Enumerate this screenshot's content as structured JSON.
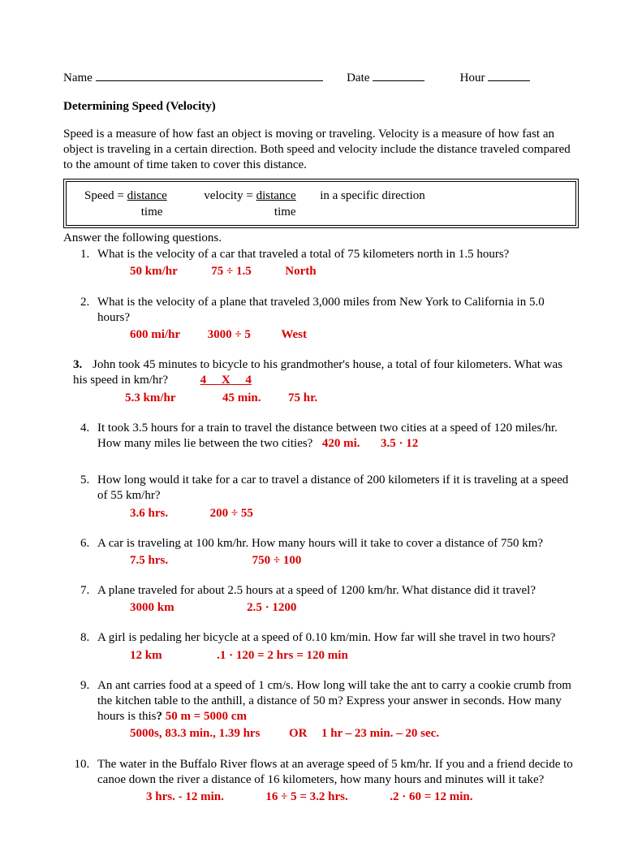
{
  "header": {
    "name_label": "Name",
    "date_label": "Date",
    "hour_label": "Hour"
  },
  "title": "Determining Speed (Velocity)",
  "intro": "Speed is a measure of how fast an object is moving or traveling.  Velocity is a measure of how fast an object is traveling in a certain direction.  Both speed and velocity include the distance traveled compared to the amount of time taken to cover this distance.",
  "formula": {
    "speed_label": "Speed = ",
    "speed_num": "distance",
    "speed_den": "time",
    "vel_label": "velocity = ",
    "vel_num": "distance",
    "vel_den": "time",
    "direction": "in a specific direction"
  },
  "answer_heading": "Answer the following questions.",
  "q1": {
    "text": "What is the velocity of a car that traveled a total of 75 kilometers north in 1.5 hours?",
    "a1": "50 km/hr",
    "a2": "75 ÷ 1.5",
    "a3": "North"
  },
  "q2": {
    "text": "What is the velocity of a plane that traveled 3,000 miles from New York to California in 5.0 hours?",
    "a1": "600  mi/hr",
    "a2": "3000  ÷  5",
    "a3": "West"
  },
  "q3": {
    "text_a": "John took 45 minutes to bicycle to his grandmother's house, a total of four kilometers.  What was his speed in km/hr?",
    "top": "4     X     4",
    "a1": "5.3 km/hr",
    "a2": "45 min.",
    "a3": "75 hr."
  },
  "q4": {
    "text": "It took 3.5 hours for a train to travel the distance between two cities at a speed of 120 miles/hr.  How many miles lie between the two cities?",
    "a1": "420 mi.",
    "a2": "3.5  ·  12"
  },
  "q5": {
    "text": "How long would it take for a car to travel a distance of 200 kilometers if it is traveling at a speed of 55 km/hr?",
    "a1": "3.6  hrs.",
    "a2": "200 ÷ 55"
  },
  "q6": {
    "text": "A car is traveling at 100 km/hr.  How many hours will it take to cover a distance of 750 km?",
    "a1": "7.5 hrs.",
    "a2": "750 ÷ 100"
  },
  "q7": {
    "text": "A plane traveled for about 2.5 hours at a speed of 1200 km/hr.  What distance did it travel?",
    "a1": "3000 km",
    "a2": "2.5  ·  1200"
  },
  "q8": {
    "text": "A girl is pedaling her bicycle at a speed of 0.10 km/min.  How far will she travel in two hours?",
    "a1": "12 km",
    "a2": ".1  ·  120  =  2 hrs  =  120 min"
  },
  "q9": {
    "text": "An ant carries food at a speed of 1 cm/s.  How long will take the ant to carry a cookie crumb from the kitchen table to the anthill, a distance of 50 m?  Express your answer in seconds.  How many hours is this",
    "q_punc": "?  ",
    "inline": "50 m  =  5000 cm",
    "a1": "5000s,   83.3 min.,  1.39 hrs",
    "or": "OR",
    "a2": "1 hr – 23 min. – 20 sec."
  },
  "q10": {
    "text": "The water in the Buffalo River flows at an average speed of 5 km/hr.  If you and a friend decide to canoe down the river a distance of 16 kilometers, how many hours and minutes will it take?",
    "a1": "3 hrs. - 12 min.",
    "a2": "16 ÷ 5 = 3.2 hrs.",
    "a3": ".2 · 60 = 12 min."
  }
}
